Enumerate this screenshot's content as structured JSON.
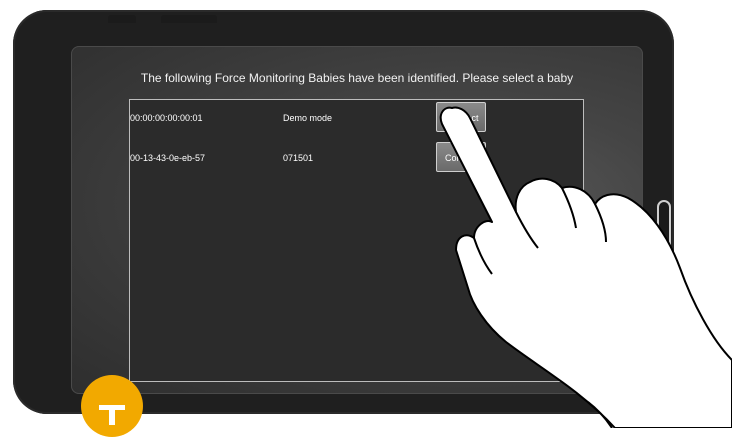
{
  "screen": {
    "title": "The following Force Monitoring Babies have been identified. Please select a baby"
  },
  "devices": [
    {
      "address": "00:00:00:00:00:01",
      "name": "Demo mode",
      "button_label": "Connect"
    },
    {
      "address": "00-13-43-0e-eb-57",
      "name": "071501",
      "button_label": "Connect"
    }
  ],
  "colors": {
    "bezel": "#1f1f1f",
    "screen": "#3c3c3c",
    "badge": "#f2a900"
  },
  "icons": {
    "hand": "pointing-hand-icon",
    "badge": "tap-badge-icon"
  }
}
